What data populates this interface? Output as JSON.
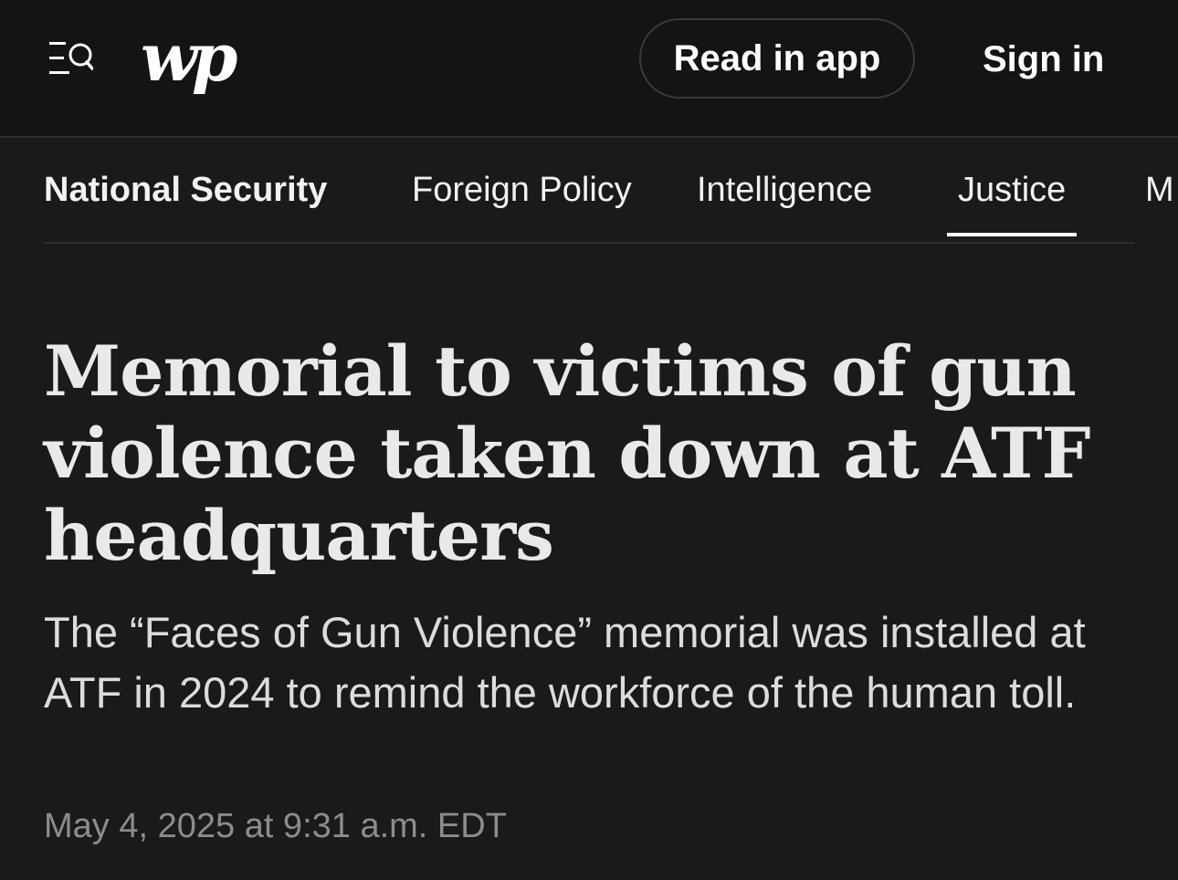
{
  "header": {
    "menu_icon": "menu-search-icon",
    "logo_text": "wp",
    "read_in_app_label": "Read in app",
    "sign_in_label": "Sign in"
  },
  "subnav": {
    "items": [
      {
        "label": "National Security",
        "section": true,
        "active": false
      },
      {
        "label": "Foreign Policy",
        "section": false,
        "active": false
      },
      {
        "label": "Intelligence",
        "section": false,
        "active": false
      },
      {
        "label": "Justice",
        "section": false,
        "active": true
      },
      {
        "label": "M",
        "section": false,
        "active": false
      }
    ]
  },
  "article": {
    "headline": "Memorial to victims of gun violence taken down at ATF headquarters",
    "dek": "The “Faces of Gun Violence” memorial was installed at ATF in 2024 to remind the workforce of the human toll.",
    "timestamp": "May 4, 2025 at 9:31 a.m. EDT"
  },
  "colors": {
    "background": "#1a1a1a",
    "topbar": "#141414",
    "text": "#e8e8e8",
    "muted": "#8c8c8c"
  }
}
